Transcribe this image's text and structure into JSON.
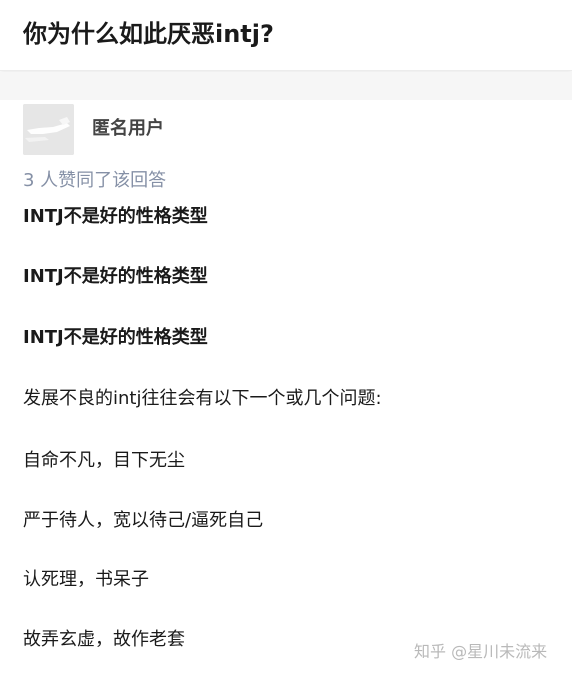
{
  "question": {
    "title": "你为什么如此厌恶intj?"
  },
  "answer": {
    "author": {
      "name": "匿名用户",
      "avatar_icon": "anonymous-avatar-icon"
    },
    "vote_text": "3 人赞同了该回答",
    "paragraphs": [
      {
        "text": "INTJ不是好的性格类型",
        "bold": true
      },
      {
        "text": "INTJ不是好的性格类型",
        "bold": true
      },
      {
        "text": "INTJ不是好的性格类型",
        "bold": true
      },
      {
        "text": "发展不良的intj往往会有以下一个或几个问题:",
        "bold": false
      },
      {
        "text": "自命不凡，目下无尘",
        "bold": false
      },
      {
        "text": "严于待人，宽以待己/逼死自己",
        "bold": false
      },
      {
        "text": "认死理，书呆子",
        "bold": false
      },
      {
        "text": "故弄玄虚，故作老套",
        "bold": false
      }
    ]
  },
  "watermark": {
    "text": "知乎 @星川未流来"
  },
  "colors": {
    "title": "#1a1a1a",
    "author": "#444444",
    "vote": "#8590a6",
    "watermark": "#b9b9b9",
    "gap": "#f6f6f6"
  }
}
